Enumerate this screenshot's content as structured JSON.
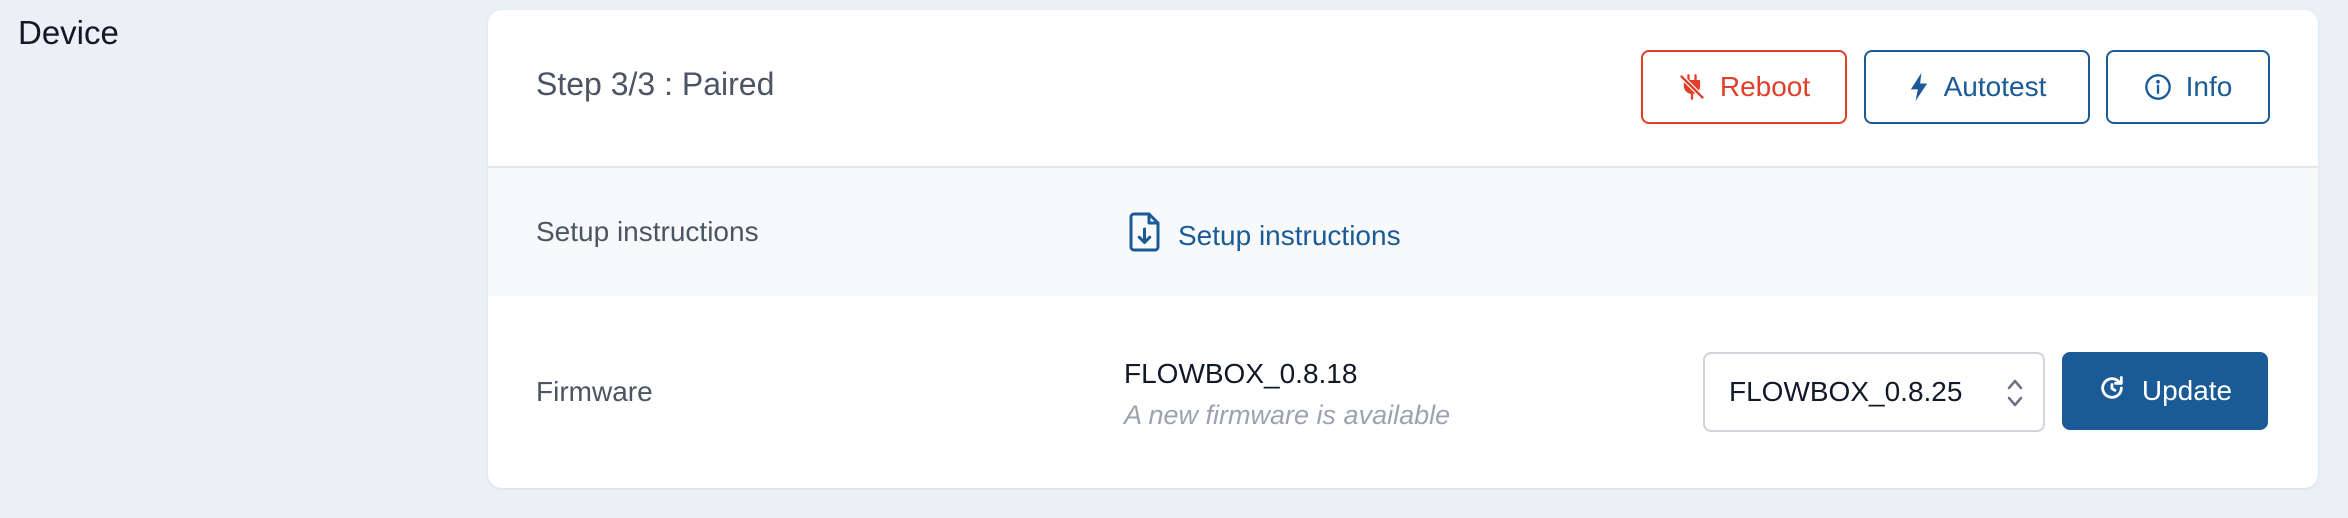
{
  "section": {
    "title": "Device"
  },
  "header": {
    "step": "Step 3/3 : Paired",
    "buttons": {
      "reboot": "Reboot",
      "autotest": "Autotest",
      "info": "Info"
    }
  },
  "setup": {
    "label": "Setup instructions",
    "link": "Setup instructions"
  },
  "firmware": {
    "label": "Firmware",
    "current": "FLOWBOX_0.8.18",
    "note": "A new firmware is available",
    "selected": "FLOWBOX_0.8.25",
    "update_label": "Update"
  },
  "colors": {
    "danger": "#e0402a",
    "primary": "#1a5a96",
    "background": "#eaf0f6"
  }
}
